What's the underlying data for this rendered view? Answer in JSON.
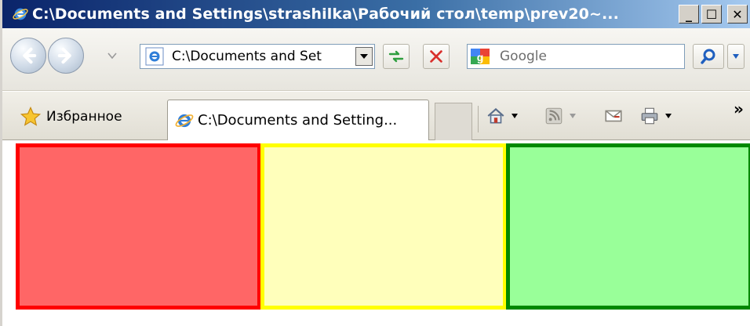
{
  "window": {
    "title": "C:\\Documents and Settings\\strashilka\\Рабочий стол\\temp\\prev20~...",
    "controls": {
      "minimize": "_",
      "maximize": "☐",
      "close": "✕"
    }
  },
  "navigation": {
    "address_value": "C:\\Documents and Set",
    "search_placeholder": "Google",
    "icons": [
      "back-icon",
      "forward-icon",
      "refresh-icon",
      "stop-icon",
      "search-icon"
    ]
  },
  "favorites_bar": {
    "favorites_label": "Избранное",
    "tab_label": "C:\\Documents and Setting...",
    "overflow": "»"
  },
  "content": {
    "boxes": [
      {
        "name": "red",
        "fill": "#ff6666",
        "border": "#ff0000"
      },
      {
        "name": "yellow",
        "fill": "#ffffbb",
        "border": "#ffff00"
      },
      {
        "name": "green",
        "fill": "#99ff99",
        "border": "#008800"
      }
    ]
  }
}
